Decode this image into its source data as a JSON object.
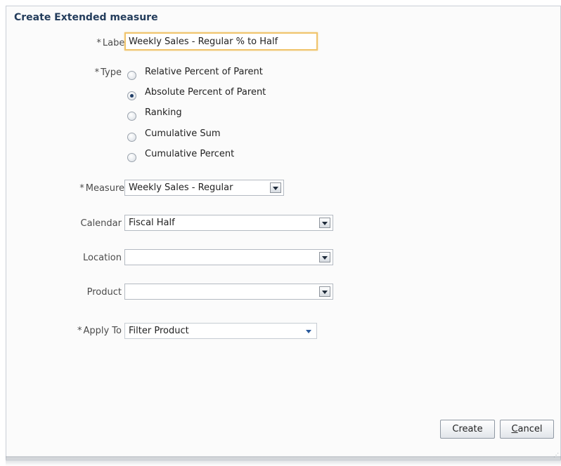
{
  "dialog": {
    "title": "Create Extended measure",
    "required_marker": "*"
  },
  "label_field": {
    "label": "Label",
    "value": "Weekly Sales - Regular % to Half"
  },
  "type_field": {
    "label": "Type",
    "options": [
      {
        "label": "Relative Percent of Parent",
        "checked": false
      },
      {
        "label": "Absolute Percent of Parent",
        "checked": true
      },
      {
        "label": "Ranking",
        "checked": false
      },
      {
        "label": "Cumulative Sum",
        "checked": false
      },
      {
        "label": "Cumulative Percent",
        "checked": false
      }
    ]
  },
  "measure_field": {
    "label": "Measure",
    "value": "Weekly Sales - Regular"
  },
  "calendar_field": {
    "label": "Calendar",
    "value": "Fiscal Half"
  },
  "location_field": {
    "label": "Location",
    "value": ""
  },
  "product_field": {
    "label": "Product",
    "value": ""
  },
  "apply_to_field": {
    "label": "Apply To",
    "value": "Filter Product"
  },
  "actions": {
    "create_label": "Create",
    "cancel_first": "C",
    "cancel_rest": "ancel"
  },
  "icons": {
    "dropdown": "chevron-down-icon",
    "resize": "resize-grip-icon"
  },
  "colors": {
    "title": "#243d5c",
    "focus_border": "#f0c46c",
    "radio_selected": "#1f3d66"
  }
}
